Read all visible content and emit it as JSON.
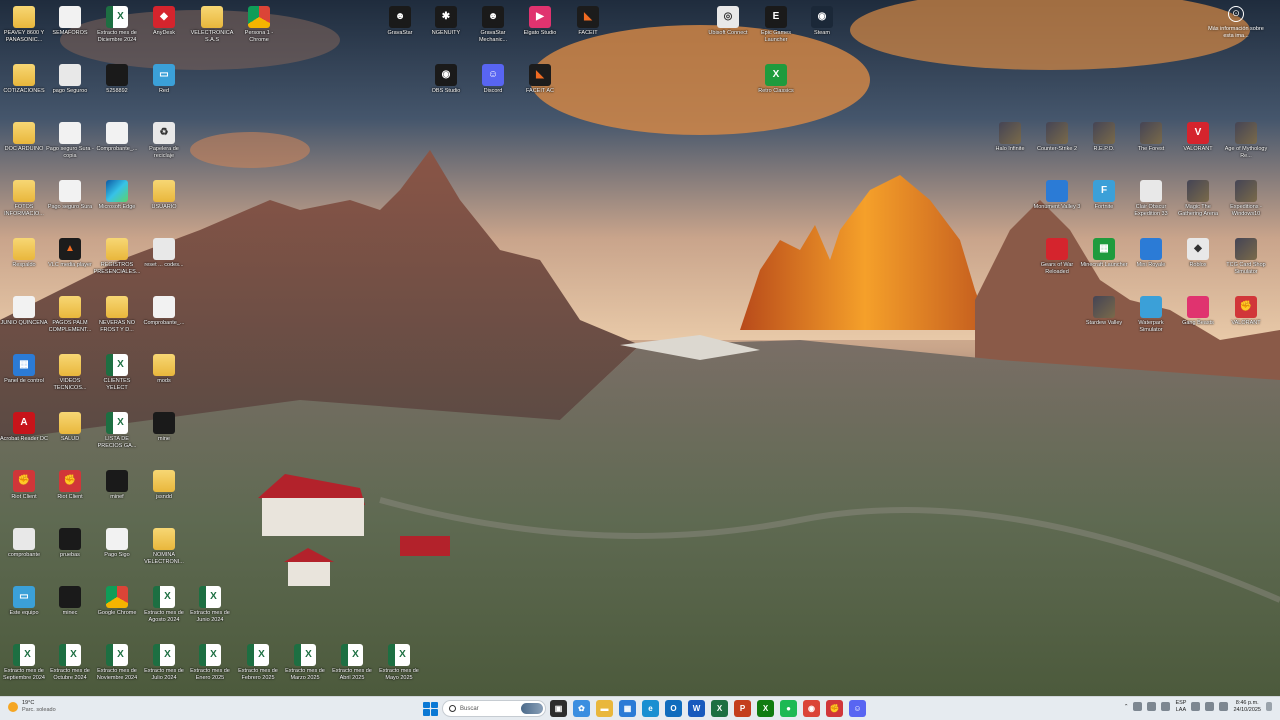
{
  "desktop": {
    "info_button_label": "Más información sobre esta ima...",
    "icons": [
      {
        "label": "PEAVEY 8600 Y PANASONIC...",
        "glyph": "",
        "style": "g-folder"
      },
      {
        "label": "SEMAFOROS",
        "glyph": "",
        "style": "g-doc"
      },
      {
        "label": "Extracto mes de Diciembre 2024",
        "glyph": "X",
        "style": "g-excel"
      },
      {
        "label": "AnyDesk",
        "glyph": "◆",
        "style": "g-red"
      },
      {
        "label": "VELECTRONICA S.A.S",
        "glyph": "",
        "style": "g-folder"
      },
      {
        "label": "Persona 1 - Chrome",
        "glyph": "",
        "style": "g-chrome"
      },
      {
        "label": "COTIZACIONES",
        "glyph": "",
        "style": "g-folder"
      },
      {
        "label": "pago Seguroo",
        "glyph": "",
        "style": "g-white"
      },
      {
        "label": "5258892",
        "glyph": "",
        "style": "g-dark"
      },
      {
        "label": "Red",
        "glyph": "▭",
        "style": "g-cyan"
      },
      {
        "label": "DOC ARDUINO",
        "glyph": "",
        "style": "g-folder"
      },
      {
        "label": "Pago seguro Sura - copia",
        "glyph": "",
        "style": "g-doc"
      },
      {
        "label": "Comprobante_...",
        "glyph": "",
        "style": "g-doc"
      },
      {
        "label": "Papelera de reciclaje",
        "glyph": "♻",
        "style": "g-white"
      },
      {
        "label": "FOTOS INFORMACIO...",
        "glyph": "",
        "style": "g-folder"
      },
      {
        "label": "Pago seguro Sura",
        "glyph": "",
        "style": "g-doc"
      },
      {
        "label": "Microsoft Edge",
        "glyph": "",
        "style": "g-edge"
      },
      {
        "label": "USUARIO",
        "glyph": "",
        "style": "g-folder"
      },
      {
        "label": "Respaldo",
        "glyph": "",
        "style": "g-folder"
      },
      {
        "label": "VLC media player",
        "glyph": "▲",
        "style": "g-orange"
      },
      {
        "label": "REGISTROS PRESENCIALES...",
        "glyph": "",
        "style": "g-folder"
      },
      {
        "label": "reset ... codes...",
        "glyph": "",
        "style": "g-white"
      },
      {
        "label": "JUNIO QUINCENA",
        "glyph": "",
        "style": "g-doc"
      },
      {
        "label": "PAGOS PALM COMPLEMENT...",
        "glyph": "",
        "style": "g-folder"
      },
      {
        "label": "NEVERAS NO FROST Y D...",
        "glyph": "",
        "style": "g-folder"
      },
      {
        "label": "Comprobante_...",
        "glyph": "",
        "style": "g-doc"
      },
      {
        "label": "Panel de control",
        "glyph": "▦",
        "style": "g-blue"
      },
      {
        "label": "VIDEOS TECNICOS...",
        "glyph": "",
        "style": "g-folder"
      },
      {
        "label": "CLIENTES YELECT",
        "glyph": "X",
        "style": "g-excel"
      },
      {
        "label": "mods",
        "glyph": "",
        "style": "g-folder"
      },
      {
        "label": "Acrobat Reader DC",
        "glyph": "A",
        "style": "g-pdf"
      },
      {
        "label": "SALUD",
        "glyph": "",
        "style": "g-folder"
      },
      {
        "label": "LISTA DE PRECIOS GA...",
        "glyph": "X",
        "style": "g-excel"
      },
      {
        "label": "mine",
        "glyph": "",
        "style": "g-dark"
      },
      {
        "label": "Riot Client",
        "glyph": "✊",
        "style": "g-riot"
      },
      {
        "label": "Riot Client",
        "glyph": "✊",
        "style": "g-riot"
      },
      {
        "label": "minef",
        "glyph": "",
        "style": "g-dark"
      },
      {
        "label": "jssndd",
        "glyph": "",
        "style": "g-folder"
      },
      {
        "label": "comprobante",
        "glyph": "",
        "style": "g-white"
      },
      {
        "label": "pruebas",
        "glyph": "",
        "style": "g-dark"
      },
      {
        "label": "Pago Sigo",
        "glyph": "",
        "style": "g-doc"
      },
      {
        "label": "NOMINA VELECTRONI...",
        "glyph": "",
        "style": "g-folder"
      },
      {
        "label": "Este equipo",
        "glyph": "▭",
        "style": "g-cyan"
      },
      {
        "label": "minec",
        "glyph": "",
        "style": "g-dark"
      },
      {
        "label": "Google Chrome",
        "glyph": "",
        "style": "g-chrome"
      },
      {
        "label": "Extracto mes de Agosto 2024",
        "glyph": "X",
        "style": "g-excel"
      },
      {
        "label": "Extracto mes de Junio 2024",
        "glyph": "X",
        "style": "g-excel"
      },
      {
        "label": "Extracto mes de Septiembre 2024",
        "glyph": "X",
        "style": "g-excel"
      },
      {
        "label": "Extracto mes de Octubre 2024",
        "glyph": "X",
        "style": "g-excel"
      },
      {
        "label": "Extracto mes de Noviembre 2024",
        "glyph": "X",
        "style": "g-excel"
      },
      {
        "label": "Extracto mes de Julio 2024",
        "glyph": "X",
        "style": "g-excel"
      },
      {
        "label": "Extracto mes de Enero 2025",
        "glyph": "X",
        "style": "g-excel"
      },
      {
        "label": "Extracto mes de Febrero 2025",
        "glyph": "X",
        "style": "g-excel"
      },
      {
        "label": "Extracto mes de Marzo 2025",
        "glyph": "X",
        "style": "g-excel"
      },
      {
        "label": "Extracto mes de Abril 2025",
        "glyph": "X",
        "style": "g-excel"
      },
      {
        "label": "Extracto mes de Mayo 2025",
        "glyph": "X",
        "style": "g-excel"
      },
      {
        "label": "GravaStar",
        "glyph": "☻",
        "style": "g-dark"
      },
      {
        "label": "NGENUITY",
        "glyph": "✱",
        "style": "g-dark"
      },
      {
        "label": "GravaStar Mechanic...",
        "glyph": "☻",
        "style": "g-dark"
      },
      {
        "label": "Elgato Studio",
        "glyph": "▶",
        "style": "g-pink"
      },
      {
        "label": "FACEIT",
        "glyph": "◣",
        "style": "g-orange"
      },
      {
        "label": "OBS Studio",
        "glyph": "◉",
        "style": "g-dark"
      },
      {
        "label": "Discord",
        "glyph": "☺",
        "style": "g-purple"
      },
      {
        "label": "FACEIT AC",
        "glyph": "◣",
        "style": "g-orange"
      },
      {
        "label": "Ubisoft Connect",
        "glyph": "◎",
        "style": "g-white"
      },
      {
        "label": "Epic Games Launcher",
        "glyph": "E",
        "style": "g-dark"
      },
      {
        "label": "Steam",
        "glyph": "◉",
        "style": "g-steam"
      },
      {
        "label": "Retro Classics",
        "glyph": "X",
        "style": "g-green"
      },
      {
        "label": "Halo Infinite",
        "glyph": "",
        "style": "g-game"
      },
      {
        "label": "Counter-Strike 2",
        "glyph": "",
        "style": "g-game"
      },
      {
        "label": "R.E.P.O.",
        "glyph": "",
        "style": "g-game"
      },
      {
        "label": "The Forest",
        "glyph": "",
        "style": "g-game"
      },
      {
        "label": "VALORANT",
        "glyph": "V",
        "style": "g-red"
      },
      {
        "label": "Age of Mythology Re...",
        "glyph": "",
        "style": "g-game"
      },
      {
        "label": "Monument Valley 3",
        "glyph": "",
        "style": "g-blue"
      },
      {
        "label": "Fortnite",
        "glyph": "F",
        "style": "g-cyan"
      },
      {
        "label": "Clair Obscur Expedition 33",
        "glyph": "",
        "style": "g-white"
      },
      {
        "label": "Magic The Gathering Arena",
        "glyph": "",
        "style": "g-game"
      },
      {
        "label": "Expeditions - Windows10",
        "glyph": "",
        "style": "g-game"
      },
      {
        "label": "Gears of War Reloaded",
        "glyph": "",
        "style": "g-red"
      },
      {
        "label": "Minecraft Launcher",
        "glyph": "▦",
        "style": "g-green"
      },
      {
        "label": "Mini Royale",
        "glyph": "",
        "style": "g-blue"
      },
      {
        "label": "Roblox",
        "glyph": "◆",
        "style": "g-white"
      },
      {
        "label": "TCG Card Shop Simulator",
        "glyph": "",
        "style": "g-game"
      },
      {
        "label": "Stardew Valley",
        "glyph": "",
        "style": "g-game"
      },
      {
        "label": "Waterpark Simulator",
        "glyph": "",
        "style": "g-cyan"
      },
      {
        "label": "Gang Beasts",
        "glyph": "",
        "style": "g-pink"
      },
      {
        "label": "VALORANT",
        "glyph": "✊",
        "style": "g-riot"
      }
    ]
  },
  "taskbar": {
    "weather_temp": "19°C",
    "weather_desc": "Parc. soleado",
    "search_placeholder": "Buscar",
    "apps": [
      {
        "name": "task-view",
        "glyph": "▣",
        "color": "#2d2d2d"
      },
      {
        "name": "copilot",
        "glyph": "✿",
        "color": "#3b8ee0"
      },
      {
        "name": "file-explorer",
        "glyph": "▬",
        "color": "#e9b73c"
      },
      {
        "name": "microsoft-store",
        "glyph": "▦",
        "color": "#2b7bd6"
      },
      {
        "name": "edge",
        "glyph": "e",
        "color": "#1a8fd1"
      },
      {
        "name": "outlook",
        "glyph": "O",
        "color": "#0f6cbd"
      },
      {
        "name": "word",
        "glyph": "W",
        "color": "#185abd"
      },
      {
        "name": "excel",
        "glyph": "X",
        "color": "#1d6f42"
      },
      {
        "name": "powerpoint",
        "glyph": "P",
        "color": "#c43e1c"
      },
      {
        "name": "xbox",
        "glyph": "X",
        "color": "#107c10"
      },
      {
        "name": "spotify",
        "glyph": "●",
        "color": "#1db954"
      },
      {
        "name": "chrome",
        "glyph": "◉",
        "color": "#db4437"
      },
      {
        "name": "riot",
        "glyph": "✊",
        "color": "#d13639"
      },
      {
        "name": "discord",
        "glyph": "☺",
        "color": "#5865f2"
      }
    ],
    "lang_top": "ESP",
    "lang_bottom": "LAA",
    "time": "8:46 p.m.",
    "date": "24/10/2025"
  }
}
